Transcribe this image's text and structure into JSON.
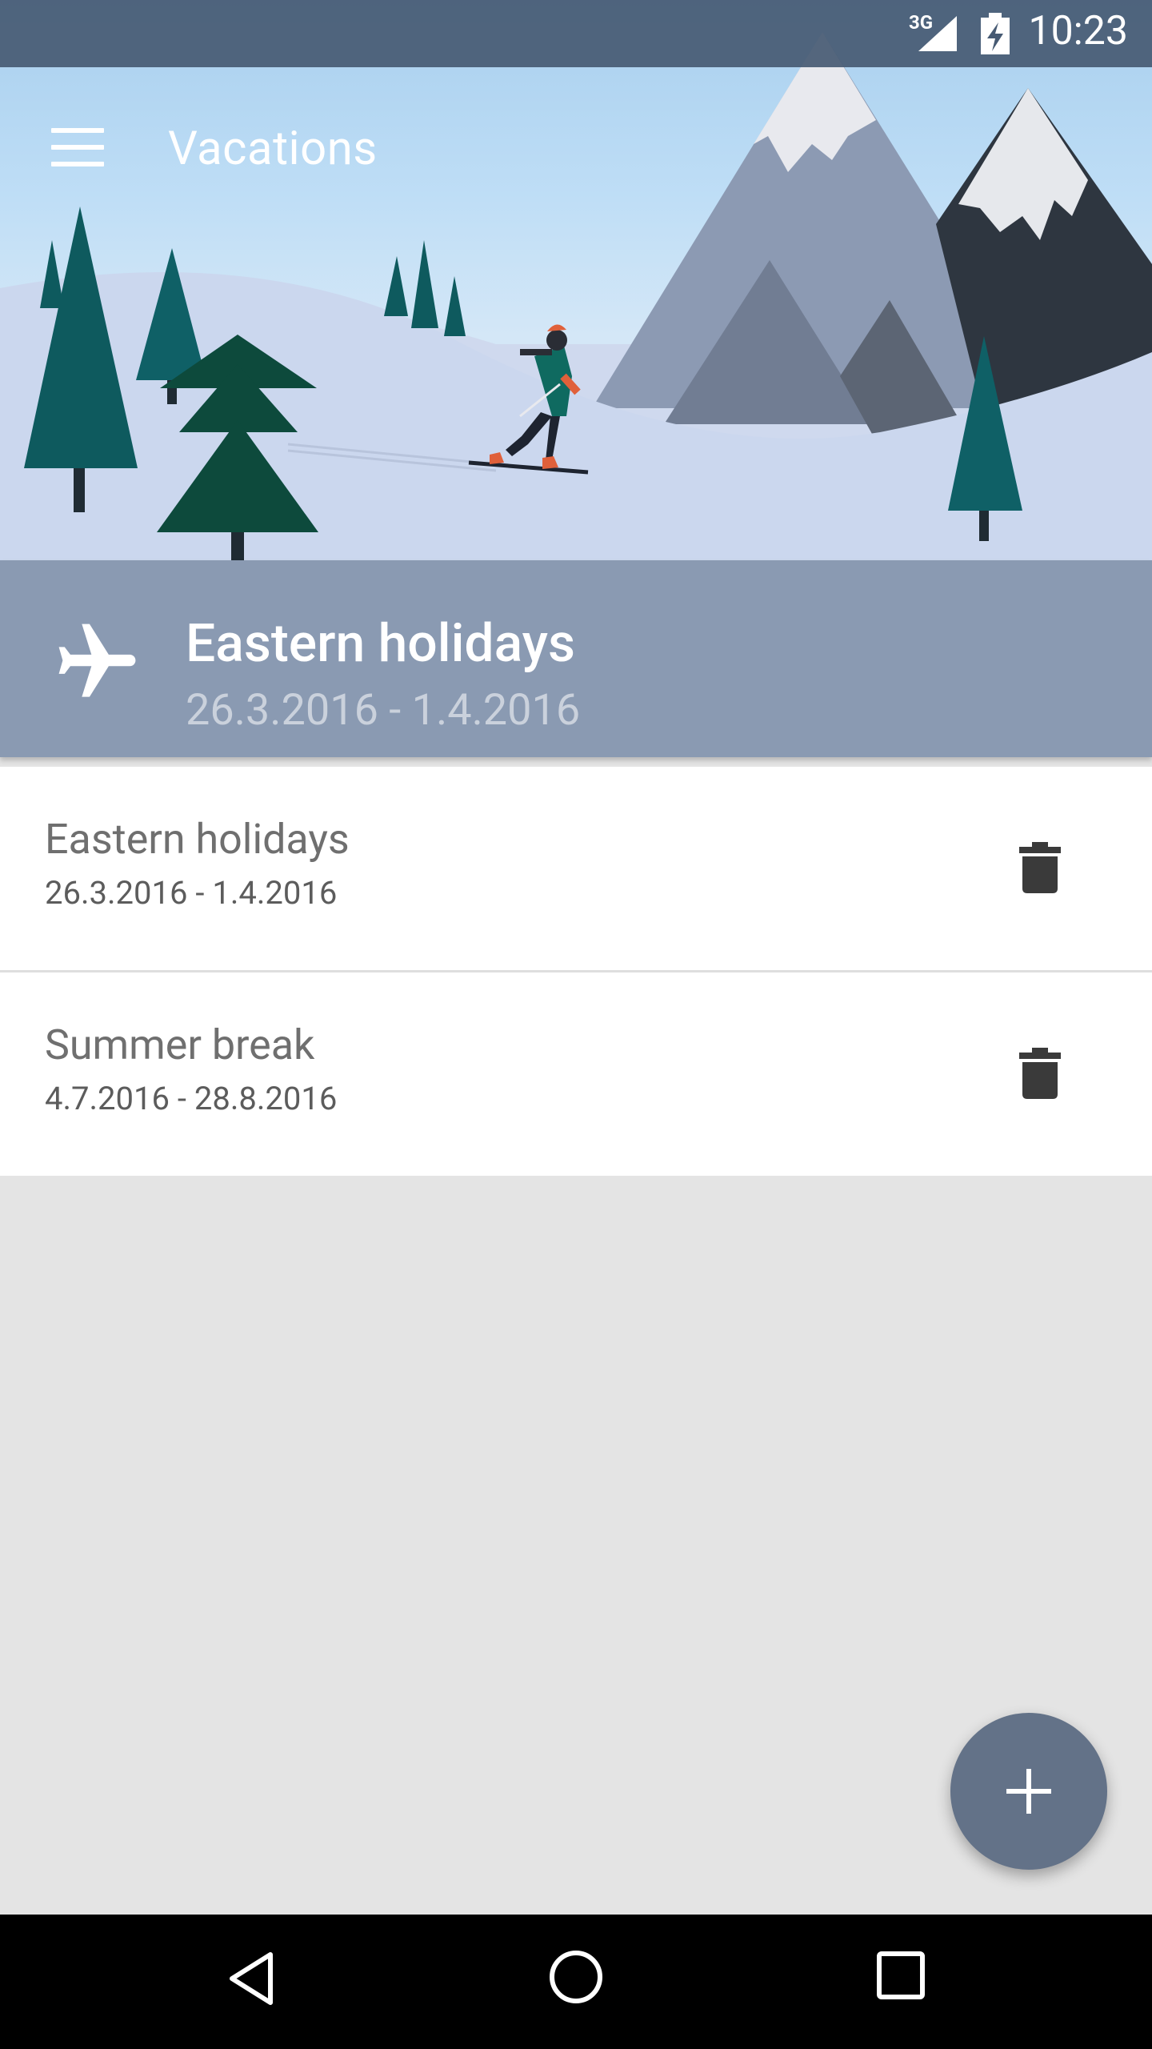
{
  "status_bar": {
    "network": "3G",
    "time": "10:23"
  },
  "app_bar": {
    "title": "Vacations",
    "menu_icon": "menu-icon"
  },
  "selected": {
    "icon": "airplane-icon",
    "title": "Eastern holidays",
    "dates": "26.3.2016 - 1.4.2016"
  },
  "vacations": [
    {
      "title": "Eastern holidays",
      "dates": "26.3.2016 - 1.4.2016",
      "action_icon": "trash-icon"
    },
    {
      "title": "Summer break",
      "dates": "4.7.2016 - 28.8.2016",
      "action_icon": "trash-icon"
    }
  ],
  "fab": {
    "icon": "plus-icon"
  },
  "nav_bar": {
    "back": "back-icon",
    "home": "home-icon",
    "recents": "recents-icon"
  },
  "colors": {
    "banner": "#8a9ab2",
    "fab": "#637288",
    "status_bar": "#465a73",
    "background": "#e4e4e4"
  }
}
